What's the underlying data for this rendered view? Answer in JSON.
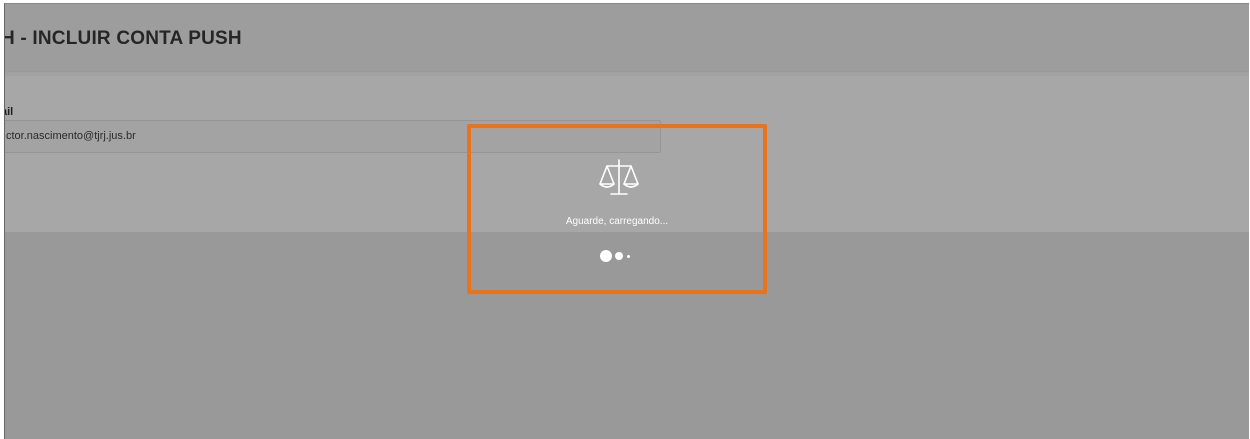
{
  "page": {
    "title": "H - INCLUIR CONTA PUSH"
  },
  "form": {
    "email_label": "ail",
    "email_value": "ctor.nascimento@tjrj.jus.br"
  },
  "loading": {
    "icon": "scales-of-justice-icon",
    "message": "Aguarde, carregando...",
    "highlight_color": "#e8731a"
  }
}
